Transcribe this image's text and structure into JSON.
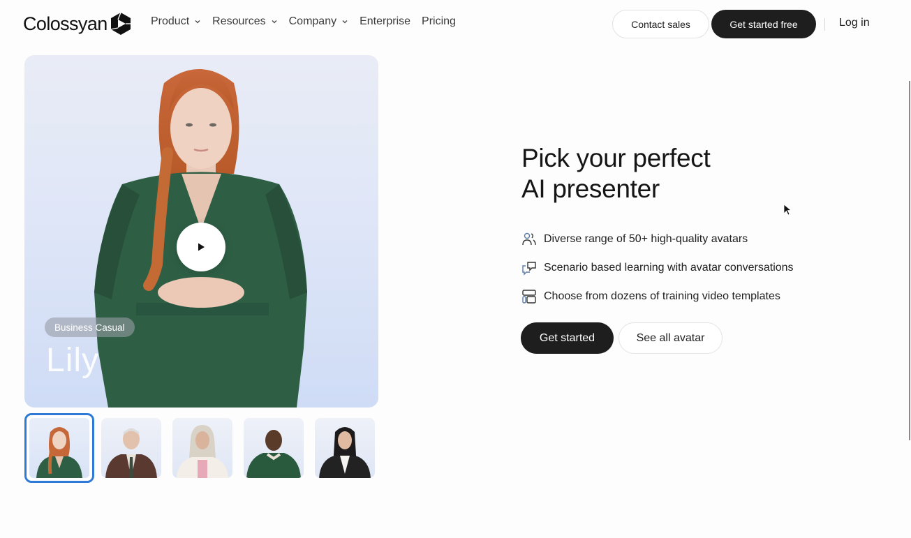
{
  "nav": {
    "brand": "Colossyan",
    "links": [
      {
        "label": "Product",
        "has_dropdown": true
      },
      {
        "label": "Resources",
        "has_dropdown": true
      },
      {
        "label": "Company",
        "has_dropdown": true
      },
      {
        "label": "Enterprise",
        "has_dropdown": false
      },
      {
        "label": "Pricing",
        "has_dropdown": false
      }
    ],
    "contact_sales": "Contact sales",
    "get_started_free": "Get started free",
    "log_in": "Log in"
  },
  "video": {
    "style_badge": "Business Casual",
    "presenter_name": "Lily",
    "play_icon": "play-icon"
  },
  "thumbnails": [
    {
      "name": "avatar-red-hair-woman",
      "selected": true
    },
    {
      "name": "avatar-older-man-suit",
      "selected": false
    },
    {
      "name": "avatar-woman-hijab",
      "selected": false
    },
    {
      "name": "avatar-man-green-hoodie",
      "selected": false
    },
    {
      "name": "avatar-woman-black-blazer",
      "selected": false
    }
  ],
  "hero": {
    "headline_line1": "Pick your perfect",
    "headline_line2": "AI presenter",
    "features": [
      {
        "icon": "users-icon",
        "text": "Diverse range of 50+ high-quality avatars"
      },
      {
        "icon": "chat-bubbles-icon",
        "text": "Scenario based learning with avatar conversations"
      },
      {
        "icon": "template-layout-icon",
        "text": "Choose from dozens of training video templates"
      }
    ],
    "primary_cta": "Get started",
    "secondary_cta": "See all avatar"
  },
  "colors": {
    "dark_button": "#1e1e1e",
    "selected_thumb_border": "#2f7ad6",
    "icon_accent": "#5b7ba8"
  }
}
